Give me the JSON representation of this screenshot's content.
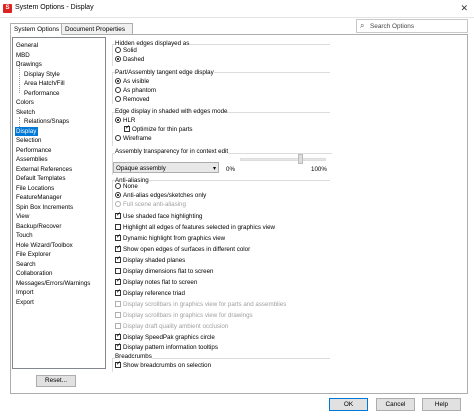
{
  "window": {
    "title": "System Options - Display",
    "app_icon": "sw-logo-icon",
    "close_icon": "close-icon"
  },
  "tabs": [
    "System Options",
    "Document Properties"
  ],
  "search": {
    "placeholder": "Search Options",
    "icon": "search-icon"
  },
  "tree": [
    {
      "label": "General"
    },
    {
      "label": "MBD"
    },
    {
      "label": "Drawings"
    },
    {
      "label": "Display Style"
    },
    {
      "label": "Area Hatch/Fill"
    },
    {
      "label": "Performance"
    },
    {
      "label": "Colors"
    },
    {
      "label": "Sketch"
    },
    {
      "label": "Relations/Snaps"
    },
    {
      "label": "Display",
      "selected": true
    },
    {
      "label": "Selection"
    },
    {
      "label": "Performance"
    },
    {
      "label": "Assemblies"
    },
    {
      "label": "External References"
    },
    {
      "label": "Default Templates"
    },
    {
      "label": "File Locations"
    },
    {
      "label": "FeatureManager"
    },
    {
      "label": "Spin Box Increments"
    },
    {
      "label": "View"
    },
    {
      "label": "Backup/Recover"
    },
    {
      "label": "Touch"
    },
    {
      "label": "Hole Wizard/Toolbox"
    },
    {
      "label": "File Explorer"
    },
    {
      "label": "Search"
    },
    {
      "label": "Collaboration"
    },
    {
      "label": "Messages/Errors/Warnings"
    },
    {
      "label": "Import"
    },
    {
      "label": "Export"
    }
  ],
  "reset_label": "Reset...",
  "hidden_edges": {
    "label": "Hidden edges displayed as",
    "options": [
      "Solid",
      "Dashed"
    ],
    "selected": "Dashed"
  },
  "tangent_edge": {
    "label": "Part/Assembly tangent edge display",
    "options": [
      "As visible",
      "As phantom",
      "Removed"
    ],
    "selected": "As visible"
  },
  "shaded_mode": {
    "label": "Edge display in shaded with edges mode",
    "hlr": "HLR",
    "optimize": "Optimize for thin parts",
    "wireframe": "Wireframe",
    "selected": "HLR"
  },
  "transparency": {
    "label": "Assembly transparency for in context edit",
    "selected": "Opaque assembly",
    "min": "0%",
    "max": "100%",
    "value_percent": 70
  },
  "anti_aliasing": {
    "label": "Anti-aliasing",
    "options": [
      "None",
      "Anti-alias edges/sketches only",
      "Full scene anti-aliasing"
    ],
    "selected": "Anti-alias edges/sketches only"
  },
  "checks": [
    {
      "label": "Use shaded face highlighting",
      "checked": true,
      "disabled": false
    },
    {
      "label": "Highlight all edges of features selected in graphics view",
      "checked": false,
      "disabled": false
    },
    {
      "label": "Dynamic highlight from graphics view",
      "checked": true,
      "disabled": false
    },
    {
      "label": "Show open edges of surfaces in different color",
      "checked": true,
      "disabled": false
    },
    {
      "label": "Display shaded planes",
      "checked": true,
      "disabled": false
    },
    {
      "label": "Display dimensions flat to screen",
      "checked": false,
      "disabled": false
    },
    {
      "label": "Display notes flat to screen",
      "checked": true,
      "disabled": false
    },
    {
      "label": "Display reference triad",
      "checked": true,
      "disabled": false
    },
    {
      "label": "Display scrollbars in graphics view for parts and assemblies",
      "checked": false,
      "disabled": true
    },
    {
      "label": "Display scrollbars in graphics view for drawings",
      "checked": false,
      "disabled": true
    },
    {
      "label": "Display draft quality ambient occlusion",
      "checked": false,
      "disabled": true
    },
    {
      "label": "Display SpeedPak graphics circle",
      "checked": true,
      "disabled": false
    },
    {
      "label": "Display pattern information tooltips",
      "checked": true,
      "disabled": false
    }
  ],
  "breadcrumbs": {
    "label": "Breadcrumbs",
    "show_label": "Show breadcrumbs on selection",
    "checked": true
  },
  "buttons": {
    "ok": "OK",
    "cancel": "Cancel",
    "help": "Help"
  },
  "colors": {
    "selection": "#0078d7",
    "border": "#adadad"
  }
}
